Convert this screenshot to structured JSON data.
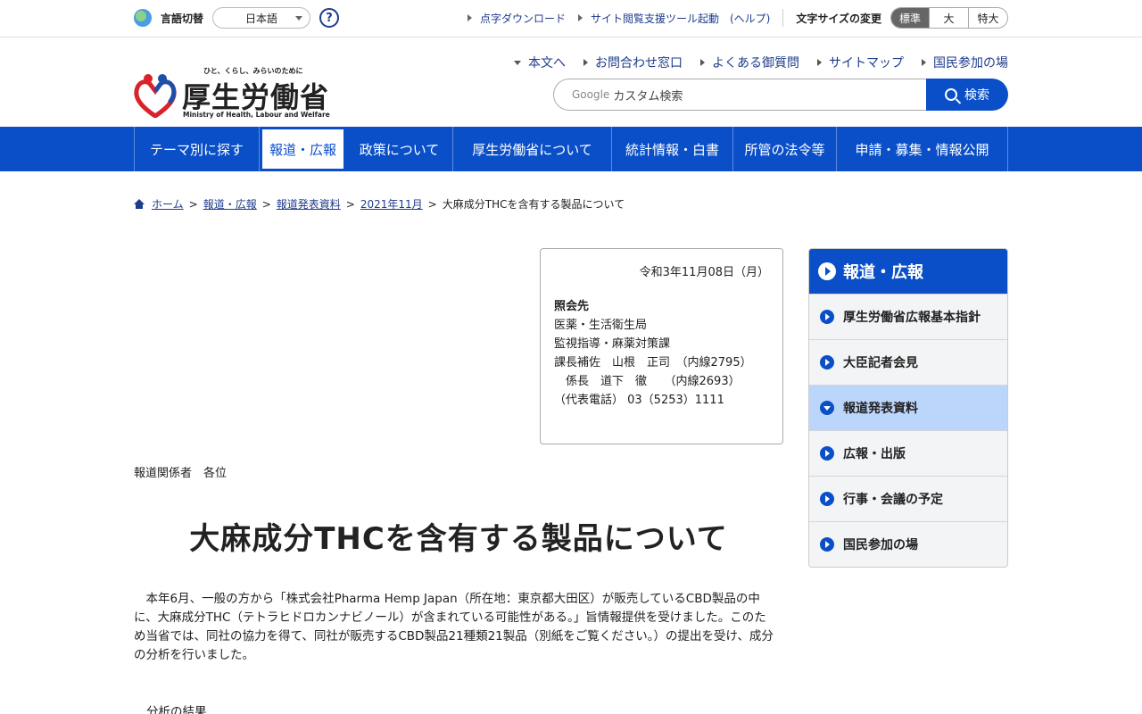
{
  "utility": {
    "lang_label": "言語切替",
    "lang_value": "日本語",
    "help": "?",
    "links": [
      "点字ダウンロード",
      "サイト閲覧支援ツール起動",
      "(ヘルプ)"
    ],
    "font_label": "文字サイズの変更",
    "font_sizes": [
      "標準",
      "大",
      "特大"
    ]
  },
  "logo": {
    "tagline": "ひと、くらし、みらいのために",
    "title": "厚生労働省",
    "english": "Ministry of Health, Labour and Welfare"
  },
  "header_links": [
    "本文へ",
    "お問合わせ窓口",
    "よくある御質問",
    "サイトマップ",
    "国民参加の場"
  ],
  "search": {
    "google": "Google",
    "placeholder": "カスタム検索",
    "button": "検索"
  },
  "gnav": [
    "テーマ別に探す",
    "報道・広報",
    "政策について",
    "厚生労働省について",
    "統計情報・白書",
    "所管の法令等",
    "申請・募集・情報公開"
  ],
  "breadcrumb": {
    "links": [
      "ホーム",
      "報道・広報",
      "報道発表資料",
      "2021年11月"
    ],
    "current": "大麻成分THCを含有する製品について"
  },
  "contact": {
    "date": "令和3年11月08日（月）",
    "heading": "照会先",
    "lines": [
      "医薬・生活衛生局",
      "監視指導・麻薬対策課",
      "課長補佐　山根　正司　（内線2795）",
      "　係長　道下　徹　　（内線2693）",
      "（代表電話） 03（5253）1111"
    ]
  },
  "addressee": "報道関係者　各位",
  "title": "大麻成分THCを含有する製品について",
  "body": "　本年6月、一般の方から「株式会社Pharma Hemp Japan（所在地：東京都大田区）が販売しているCBD製品の中に、大麻成分THC（テトラヒドロカンナビノール）が含まれている可能性がある。」旨情報提供を受けました。このため当省では、同社の協力を得て、同社が販売するCBD製品21種類21製品（別紙をご覧ください。）の提出を受け、成分の分析を行いました。",
  "section_label": "分析の結果",
  "side": {
    "heading": "報道・広報",
    "items": [
      "厚生労働省広報基本指針",
      "大臣記者会見",
      "報道発表資料",
      "広報・出版",
      "行事・会議の予定",
      "国民参加の場"
    ]
  }
}
